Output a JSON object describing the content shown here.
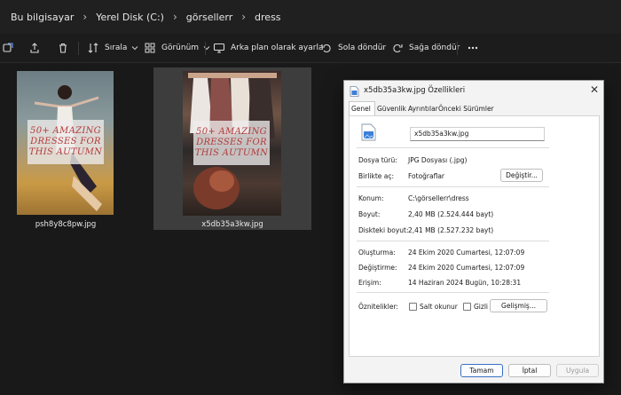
{
  "breadcrumb": [
    "Bu bilgisayar",
    "Yerel Disk (C:)",
    "görsellerr",
    "dress"
  ],
  "toolbar": {
    "sort_label": "Sırala",
    "view_label": "Görünüm",
    "set_background_label": "Arka plan olarak ayarla",
    "rotate_left_label": "Sola döndür",
    "rotate_right_label": "Sağa döndür"
  },
  "files": [
    {
      "name": "psh8y8c8pw.jpg",
      "overlay_text": "50+ AMAZING DRESSES FOR THIS AUTUMN",
      "selected": false
    },
    {
      "name": "x5db35a3kw.jpg",
      "overlay_text": "50+ AMAZING DRESSES FOR THIS AUTUMN",
      "selected": true
    }
  ],
  "dialog": {
    "title": "x5db35a3kw.jpg Özellikleri",
    "tabs": [
      "Genel",
      "Güvenlik",
      "Ayrıntılar",
      "Önceki Sürümler"
    ],
    "filename_value": "x5db35a3kw.jpg",
    "rows": {
      "type_label": "Dosya türü:",
      "type_value": "JPG Dosyası (.jpg)",
      "opens_label": "Birlikte aç:",
      "opens_value": "Fotoğraflar",
      "change_button": "Değiştir...",
      "location_label": "Konum:",
      "location_value": "C:\\görsellerr\\dress",
      "size_label": "Boyut:",
      "size_value": "2,40 MB (2.524.444 bayt)",
      "disk_size_label": "Diskteki boyut:",
      "disk_size_value": "2,41 MB (2.527.232 bayt)",
      "created_label": "Oluşturma:",
      "created_value": "24 Ekim 2020 Cumartesi, 12:07:09",
      "modified_label": "Değiştirme:",
      "modified_value": "24 Ekim 2020 Cumartesi, 12:07:09",
      "accessed_label": "Erişim:",
      "accessed_value": "14 Haziran 2024 Bugün, 10:28:31",
      "attributes_label": "Öznitelikler:",
      "readonly_label": "Salt okunur",
      "hidden_label": "Gizli",
      "advanced_button": "Gelişmiş..."
    },
    "buttons": {
      "ok": "Tamam",
      "cancel": "İptal",
      "apply": "Uygula"
    }
  }
}
